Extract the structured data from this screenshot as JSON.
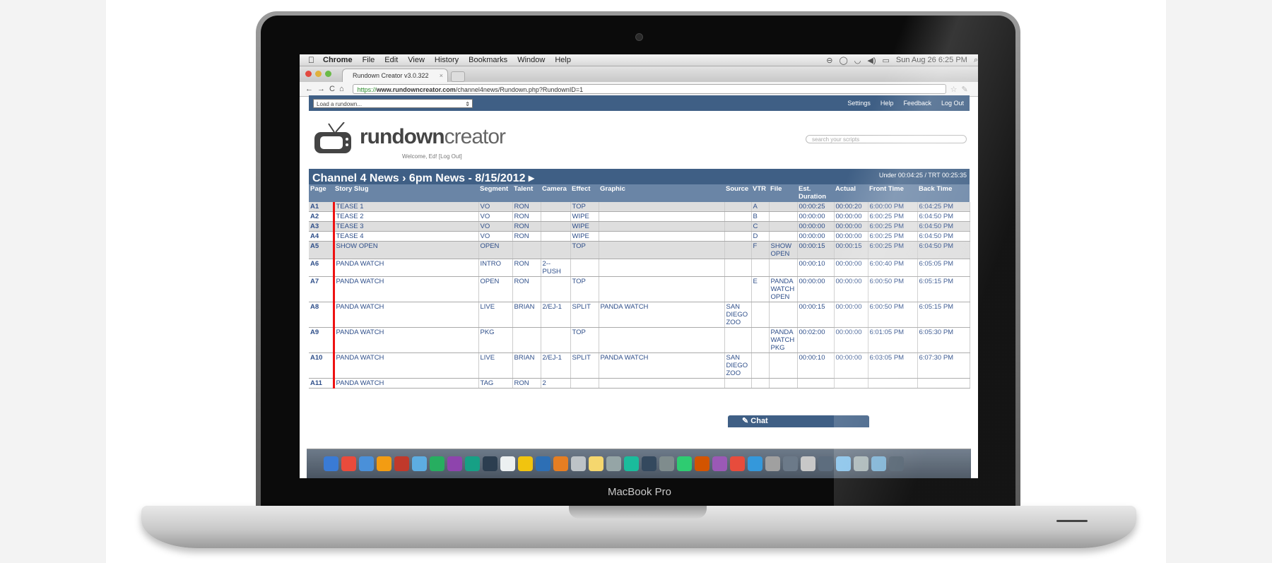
{
  "laptop": {
    "model_label": "MacBook Pro"
  },
  "menubar": {
    "app_name": "Chrome",
    "items": [
      "File",
      "Edit",
      "View",
      "History",
      "Bookmarks",
      "Window",
      "Help"
    ],
    "clock": "Sun Aug 26  6:25 PM"
  },
  "browser": {
    "tab_title": "Rundown Creator v3.0.322",
    "url_scheme": "https://",
    "url_host": "www.rundowncreator.com",
    "url_path": "/channel4news/Rundown.php?RundownID=1"
  },
  "app": {
    "load_placeholder": "Load a rundown...",
    "header_links": [
      "Settings",
      "Help",
      "Feedback",
      "Log Out"
    ],
    "brand_bold": "rundown",
    "brand_light": "creator",
    "welcome": "Welcome, Ed!  [Log Out]",
    "search_placeholder": "search your scripts",
    "rundown_title": "Channel 4 News › 6pm News - 8/15/2012 ▸",
    "under_trt": "Under 00:04:25 / TRT 00:25:35",
    "columns": [
      "Page",
      "Story Slug",
      "Segment",
      "Talent",
      "Camera",
      "Effect",
      "Graphic",
      "Source",
      "VTR",
      "File",
      "Est. Duration",
      "Actual",
      "Front Time",
      "Back Time"
    ],
    "rows": [
      {
        "page": "A1",
        "slug": "TEASE 1",
        "segment": "VO",
        "talent": "RON",
        "camera": "",
        "effect": "TOP",
        "graphic": "",
        "source": "",
        "vtr": "A",
        "file": "",
        "est": "00:00:25",
        "actual": "00:00:20",
        "front": "6:00:00 PM",
        "back": "6:04:25 PM"
      },
      {
        "page": "A2",
        "slug": "TEASE 2",
        "segment": "VO",
        "talent": "RON",
        "camera": "",
        "effect": "WIPE",
        "graphic": "",
        "source": "",
        "vtr": "B",
        "file": "",
        "est": "00:00:00",
        "actual": "00:00:00",
        "front": "6:00:25 PM",
        "back": "6:04:50 PM"
      },
      {
        "page": "A3",
        "slug": "TEASE 3",
        "segment": "VO",
        "talent": "RON",
        "camera": "",
        "effect": "WIPE",
        "graphic": "",
        "source": "",
        "vtr": "C",
        "file": "",
        "est": "00:00:00",
        "actual": "00:00:00",
        "front": "6:00:25 PM",
        "back": "6:04:50 PM"
      },
      {
        "page": "A4",
        "slug": "TEASE 4",
        "segment": "VO",
        "talent": "RON",
        "camera": "",
        "effect": "WIPE",
        "graphic": "",
        "source": "",
        "vtr": "D",
        "file": "",
        "est": "00:00:00",
        "actual": "00:00:00",
        "front": "6:00:25 PM",
        "back": "6:04:50 PM"
      },
      {
        "page": "A5",
        "slug": "SHOW OPEN",
        "segment": "OPEN",
        "talent": "",
        "camera": "",
        "effect": "TOP",
        "graphic": "",
        "source": "",
        "vtr": "F",
        "file": "SHOW OPEN",
        "est": "00:00:15",
        "actual": "00:00:15",
        "front": "6:00:25 PM",
        "back": "6:04:50 PM"
      },
      {
        "page": "A6",
        "slug": "PANDA WATCH",
        "segment": "INTRO",
        "talent": "RON",
        "camera": "2-- PUSH",
        "effect": "",
        "graphic": "",
        "source": "",
        "vtr": "",
        "file": "",
        "est": "00:00:10",
        "actual": "00:00:00",
        "front": "6:00:40 PM",
        "back": "6:05:05 PM"
      },
      {
        "page": "A7",
        "slug": "PANDA WATCH",
        "segment": "OPEN",
        "talent": "RON",
        "camera": "",
        "effect": "TOP",
        "graphic": "",
        "source": "",
        "vtr": "E",
        "file": "PANDA WATCH OPEN",
        "est": "00:00:00",
        "actual": "00:00:00",
        "front": "6:00:50 PM",
        "back": "6:05:15 PM"
      },
      {
        "page": "A8",
        "slug": "PANDA WATCH",
        "segment": "LIVE",
        "talent": "BRIAN",
        "camera": "2/EJ-1",
        "effect": "SPLIT",
        "graphic": "PANDA WATCH",
        "source": "SAN DIEGO ZOO",
        "vtr": "",
        "file": "",
        "est": "00:00:15",
        "actual": "00:00:00",
        "front": "6:00:50 PM",
        "back": "6:05:15 PM"
      },
      {
        "page": "A9",
        "slug": "PANDA WATCH",
        "segment": "PKG",
        "talent": "",
        "camera": "",
        "effect": "TOP",
        "graphic": "",
        "source": "",
        "vtr": "",
        "file": "PANDA WATCH PKG",
        "est": "00:02:00",
        "actual": "00:00:00",
        "front": "6:01:05 PM",
        "back": "6:05:30 PM"
      },
      {
        "page": "A10",
        "slug": "PANDA WATCH",
        "segment": "LIVE",
        "talent": "BRIAN",
        "camera": "2/EJ-1",
        "effect": "SPLIT",
        "graphic": "PANDA WATCH",
        "source": "SAN DIEGO ZOO",
        "vtr": "",
        "file": "",
        "est": "00:00:10",
        "actual": "00:00:00",
        "front": "6:03:05 PM",
        "back": "6:07:30 PM"
      },
      {
        "page": "A11",
        "slug": "PANDA WATCH",
        "segment": "TAG",
        "talent": "RON",
        "camera": "2",
        "effect": "",
        "graphic": "",
        "source": "",
        "vtr": "",
        "file": "",
        "est": "",
        "actual": "",
        "front": "",
        "back": ""
      }
    ],
    "chat_label": "Chat"
  }
}
